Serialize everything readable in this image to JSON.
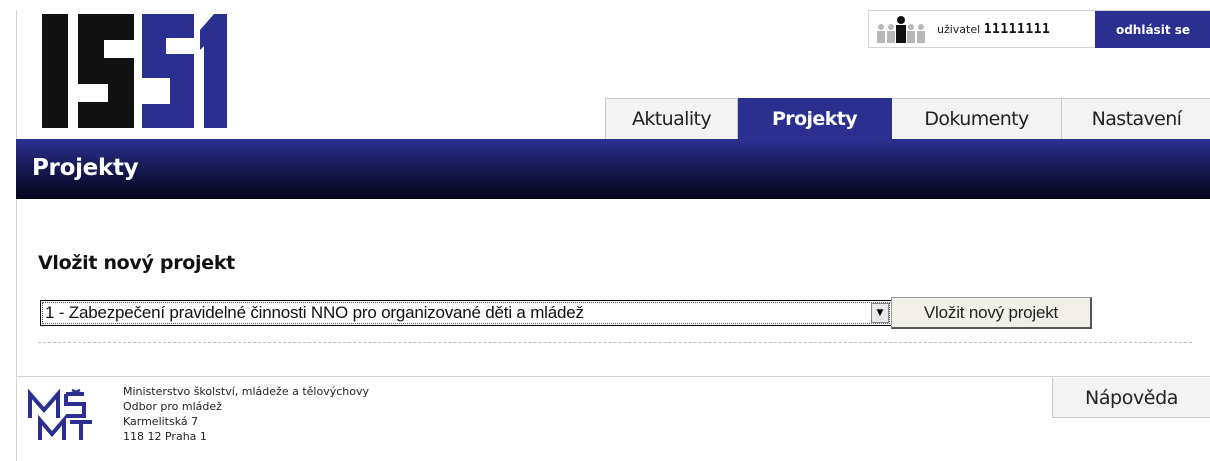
{
  "brand": {
    "logo_text": "IS51",
    "accent_color": "#2b2f8f"
  },
  "user": {
    "label": "uživatel",
    "id": "11111111",
    "logout_label": "odhlásit se",
    "icon": "users-icon"
  },
  "nav": {
    "tabs": [
      {
        "label": "Aktuality",
        "active": false
      },
      {
        "label": "Projekty",
        "active": true
      },
      {
        "label": "Dokumenty",
        "active": false
      },
      {
        "label": "Nastavení",
        "active": false
      }
    ]
  },
  "page": {
    "title": "Projekty"
  },
  "form": {
    "heading": "Vložit nový projekt",
    "select_value": "1 - Zabezpečení pravidelné činnosti NNO pro organizované děti a mládež",
    "submit_label": "Vložit nový projekt"
  },
  "footer": {
    "org_lines": [
      "Ministerstvo školství, mládeže a tělovýchovy",
      "Odbor pro mládež",
      "Karmelitská 7",
      "118 12 Praha 1"
    ],
    "logo_text": "MŠMT",
    "help_label": "Nápověda"
  }
}
